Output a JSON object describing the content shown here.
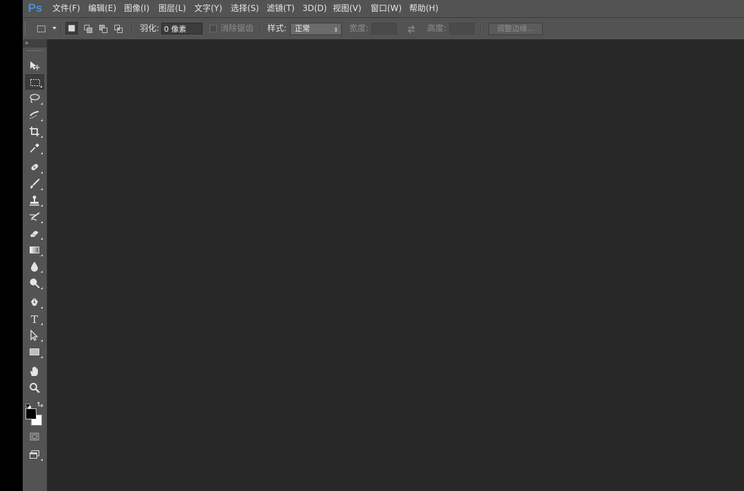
{
  "app": {
    "logo_text": "Ps",
    "accent": "#4a90d9",
    "workspace_color": "#282828"
  },
  "menus": [
    {
      "id": "file",
      "label": "文件(F)"
    },
    {
      "id": "edit",
      "label": "编辑(E)"
    },
    {
      "id": "image",
      "label": "图像(I)"
    },
    {
      "id": "layer",
      "label": "图层(L)"
    },
    {
      "id": "type",
      "label": "文字(Y)"
    },
    {
      "id": "select",
      "label": "选择(S)"
    },
    {
      "id": "filter",
      "label": "滤镜(T)"
    },
    {
      "id": "3d",
      "label": "3D(D)"
    },
    {
      "id": "view",
      "label": "视图(V)"
    },
    {
      "id": "window",
      "label": "窗口(W)"
    },
    {
      "id": "help",
      "label": "帮助(H)"
    }
  ],
  "options": {
    "feather_label": "羽化:",
    "feather_value": "0 像素",
    "antialias_label": "消除锯齿",
    "style_label": "样式:",
    "style_value": "正常",
    "width_label": "宽度:",
    "height_label": "高度:",
    "refine_edge_label": "调整边缘..."
  },
  "tools": [
    {
      "id": "move",
      "icon": "move-icon"
    },
    {
      "id": "marquee",
      "icon": "rect-marquee-icon",
      "selected": true
    },
    {
      "id": "lasso",
      "icon": "lasso-icon"
    },
    {
      "id": "quick-select",
      "icon": "quick-select-icon"
    },
    {
      "id": "crop",
      "icon": "crop-icon"
    },
    {
      "id": "eyedropper",
      "icon": "eyedropper-icon"
    },
    {
      "id": "healing",
      "icon": "healing-brush-icon"
    },
    {
      "id": "brush",
      "icon": "brush-icon"
    },
    {
      "id": "stamp",
      "icon": "clone-stamp-icon"
    },
    {
      "id": "history-brush",
      "icon": "history-brush-icon"
    },
    {
      "id": "eraser",
      "icon": "eraser-icon"
    },
    {
      "id": "gradient",
      "icon": "gradient-icon"
    },
    {
      "id": "blur",
      "icon": "blur-icon"
    },
    {
      "id": "dodge",
      "icon": "dodge-icon"
    },
    {
      "id": "pen",
      "icon": "pen-icon"
    },
    {
      "id": "type",
      "icon": "type-icon"
    },
    {
      "id": "path-select",
      "icon": "path-select-icon"
    },
    {
      "id": "shape",
      "icon": "rectangle-shape-icon"
    },
    {
      "id": "hand",
      "icon": "hand-icon"
    },
    {
      "id": "zoom",
      "icon": "zoom-icon"
    }
  ],
  "colors": {
    "foreground": "#000000",
    "background": "#ffffff"
  },
  "toolbar_collapse_glyph": "»",
  "type_tool_glyph": "T"
}
